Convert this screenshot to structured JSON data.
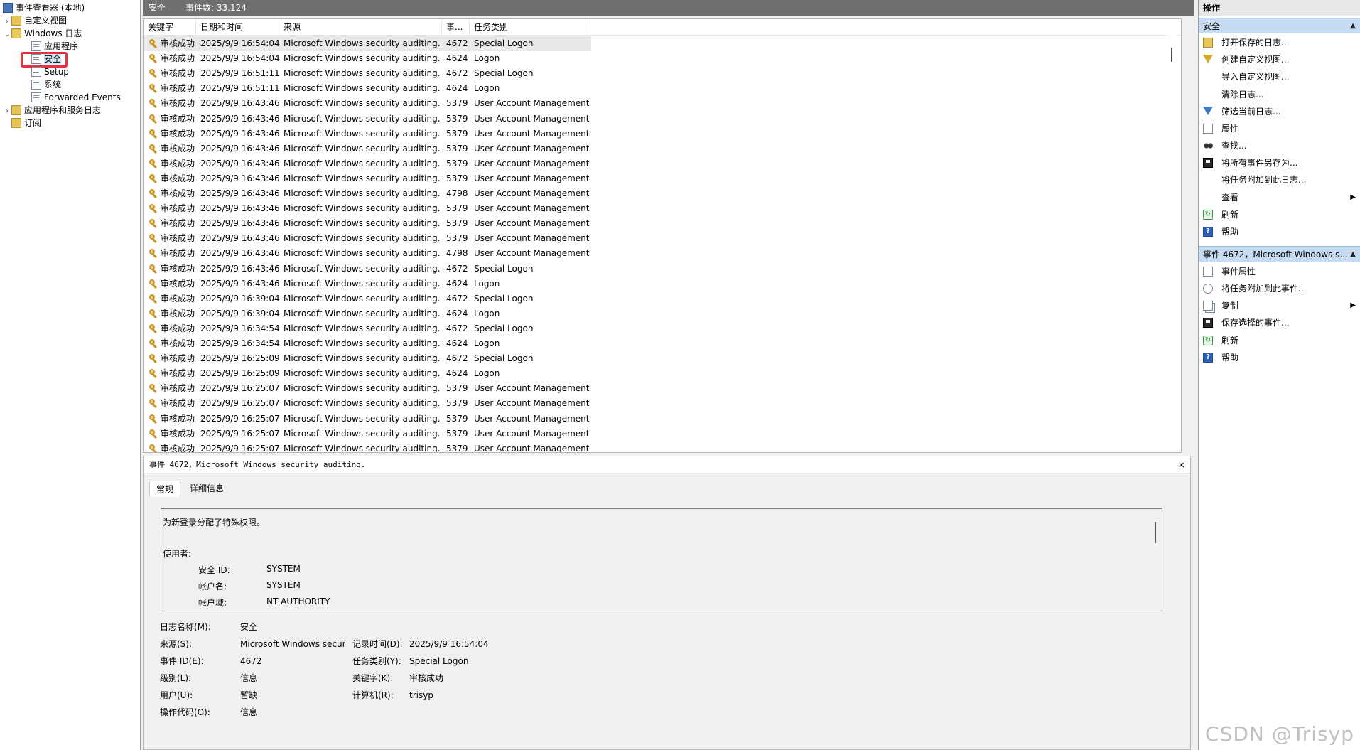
{
  "tree": {
    "root": "事件查看器 (本地)",
    "custom_views": "自定义视图",
    "windows_logs": "Windows 日志",
    "app": "应用程序",
    "security": "安全",
    "setup": "Setup",
    "system": "系统",
    "forwarded": "Forwarded Events",
    "app_service_logs": "应用程序和服务日志",
    "subscriptions": "订阅"
  },
  "header": {
    "log_name": "安全",
    "event_count": "事件数: 33,124"
  },
  "columns": {
    "keyword": "关键字",
    "datetime": "日期和时间",
    "source": "来源",
    "event_id": "事...",
    "task": "任务类别"
  },
  "rows": [
    {
      "k": "审核成功",
      "d": "2025/9/9 16:54:04",
      "s": "Microsoft Windows security auditing.",
      "id": "4672",
      "t": "Special Logon"
    },
    {
      "k": "审核成功",
      "d": "2025/9/9 16:54:04",
      "s": "Microsoft Windows security auditing.",
      "id": "4624",
      "t": "Logon"
    },
    {
      "k": "审核成功",
      "d": "2025/9/9 16:51:11",
      "s": "Microsoft Windows security auditing.",
      "id": "4672",
      "t": "Special Logon"
    },
    {
      "k": "审核成功",
      "d": "2025/9/9 16:51:11",
      "s": "Microsoft Windows security auditing.",
      "id": "4624",
      "t": "Logon"
    },
    {
      "k": "审核成功",
      "d": "2025/9/9 16:43:46",
      "s": "Microsoft Windows security auditing.",
      "id": "5379",
      "t": "User Account Management"
    },
    {
      "k": "审核成功",
      "d": "2025/9/9 16:43:46",
      "s": "Microsoft Windows security auditing.",
      "id": "5379",
      "t": "User Account Management"
    },
    {
      "k": "审核成功",
      "d": "2025/9/9 16:43:46",
      "s": "Microsoft Windows security auditing.",
      "id": "5379",
      "t": "User Account Management"
    },
    {
      "k": "审核成功",
      "d": "2025/9/9 16:43:46",
      "s": "Microsoft Windows security auditing.",
      "id": "5379",
      "t": "User Account Management"
    },
    {
      "k": "审核成功",
      "d": "2025/9/9 16:43:46",
      "s": "Microsoft Windows security auditing.",
      "id": "5379",
      "t": "User Account Management"
    },
    {
      "k": "审核成功",
      "d": "2025/9/9 16:43:46",
      "s": "Microsoft Windows security auditing.",
      "id": "5379",
      "t": "User Account Management"
    },
    {
      "k": "审核成功",
      "d": "2025/9/9 16:43:46",
      "s": "Microsoft Windows security auditing.",
      "id": "4798",
      "t": "User Account Management"
    },
    {
      "k": "审核成功",
      "d": "2025/9/9 16:43:46",
      "s": "Microsoft Windows security auditing.",
      "id": "5379",
      "t": "User Account Management"
    },
    {
      "k": "审核成功",
      "d": "2025/9/9 16:43:46",
      "s": "Microsoft Windows security auditing.",
      "id": "5379",
      "t": "User Account Management"
    },
    {
      "k": "审核成功",
      "d": "2025/9/9 16:43:46",
      "s": "Microsoft Windows security auditing.",
      "id": "5379",
      "t": "User Account Management"
    },
    {
      "k": "审核成功",
      "d": "2025/9/9 16:43:46",
      "s": "Microsoft Windows security auditing.",
      "id": "4798",
      "t": "User Account Management"
    },
    {
      "k": "审核成功",
      "d": "2025/9/9 16:43:46",
      "s": "Microsoft Windows security auditing.",
      "id": "4672",
      "t": "Special Logon"
    },
    {
      "k": "审核成功",
      "d": "2025/9/9 16:43:46",
      "s": "Microsoft Windows security auditing.",
      "id": "4624",
      "t": "Logon"
    },
    {
      "k": "审核成功",
      "d": "2025/9/9 16:39:04",
      "s": "Microsoft Windows security auditing.",
      "id": "4672",
      "t": "Special Logon"
    },
    {
      "k": "审核成功",
      "d": "2025/9/9 16:39:04",
      "s": "Microsoft Windows security auditing.",
      "id": "4624",
      "t": "Logon"
    },
    {
      "k": "审核成功",
      "d": "2025/9/9 16:34:54",
      "s": "Microsoft Windows security auditing.",
      "id": "4672",
      "t": "Special Logon"
    },
    {
      "k": "审核成功",
      "d": "2025/9/9 16:34:54",
      "s": "Microsoft Windows security auditing.",
      "id": "4624",
      "t": "Logon"
    },
    {
      "k": "审核成功",
      "d": "2025/9/9 16:25:09",
      "s": "Microsoft Windows security auditing.",
      "id": "4672",
      "t": "Special Logon"
    },
    {
      "k": "审核成功",
      "d": "2025/9/9 16:25:09",
      "s": "Microsoft Windows security auditing.",
      "id": "4624",
      "t": "Logon"
    },
    {
      "k": "审核成功",
      "d": "2025/9/9 16:25:07",
      "s": "Microsoft Windows security auditing.",
      "id": "5379",
      "t": "User Account Management"
    },
    {
      "k": "审核成功",
      "d": "2025/9/9 16:25:07",
      "s": "Microsoft Windows security auditing.",
      "id": "5379",
      "t": "User Account Management"
    },
    {
      "k": "审核成功",
      "d": "2025/9/9 16:25:07",
      "s": "Microsoft Windows security auditing.",
      "id": "5379",
      "t": "User Account Management"
    },
    {
      "k": "审核成功",
      "d": "2025/9/9 16:25:07",
      "s": "Microsoft Windows security auditing.",
      "id": "5379",
      "t": "User Account Management"
    },
    {
      "k": "审核成功",
      "d": "2025/9/9 16:25:07",
      "s": "Microsoft Windows security auditing.",
      "id": "5379",
      "t": "User Account Management"
    }
  ],
  "detail": {
    "title": "事件 4672，Microsoft Windows security auditing.",
    "close": "✕",
    "tab_general": "常规",
    "tab_details": "详细信息",
    "desc": "为新登录分配了特殊权限。",
    "subject_label": "使用者:",
    "sid_label": "安全 ID:",
    "sid_value": "SYSTEM",
    "account_label": "帐户名:",
    "account_value": "SYSTEM",
    "domain_label": "帐户域:",
    "domain_value": "NT AUTHORITY",
    "log_name_label": "日志名称(M):",
    "log_name_value": "安全",
    "source_label": "来源(S):",
    "source_value": "Microsoft Windows secur",
    "recorded_label": "记录时间(D):",
    "recorded_value": "2025/9/9 16:54:04",
    "eventid_label": "事件 ID(E):",
    "eventid_value": "4672",
    "task_label": "任务类别(Y):",
    "task_value": "Special Logon",
    "level_label": "级别(L):",
    "level_value": "信息",
    "keyword_label": "关键字(K):",
    "keyword_value": "审核成功",
    "user_label": "用户(U):",
    "user_value": "暂缺",
    "computer_label": "计算机(R):",
    "computer_value": "trisyp",
    "opcode_label": "操作代码(O):",
    "opcode_value": "信息"
  },
  "actions": {
    "header": "操作",
    "section1": "安全",
    "items1": [
      "打开保存的日志...",
      "创建自定义视图...",
      "导入自定义视图...",
      "清除日志...",
      "筛选当前日志...",
      "属性",
      "查找...",
      "将所有事件另存为...",
      "将任务附加到此日志...",
      "查看",
      "刷新",
      "帮助"
    ],
    "section2": "事件 4672，Microsoft Windows s...",
    "items2": [
      "事件属性",
      "将任务附加到此事件...",
      "复制",
      "保存选择的事件...",
      "刷新",
      "帮助"
    ]
  },
  "watermark": "CSDN @Trisyp"
}
